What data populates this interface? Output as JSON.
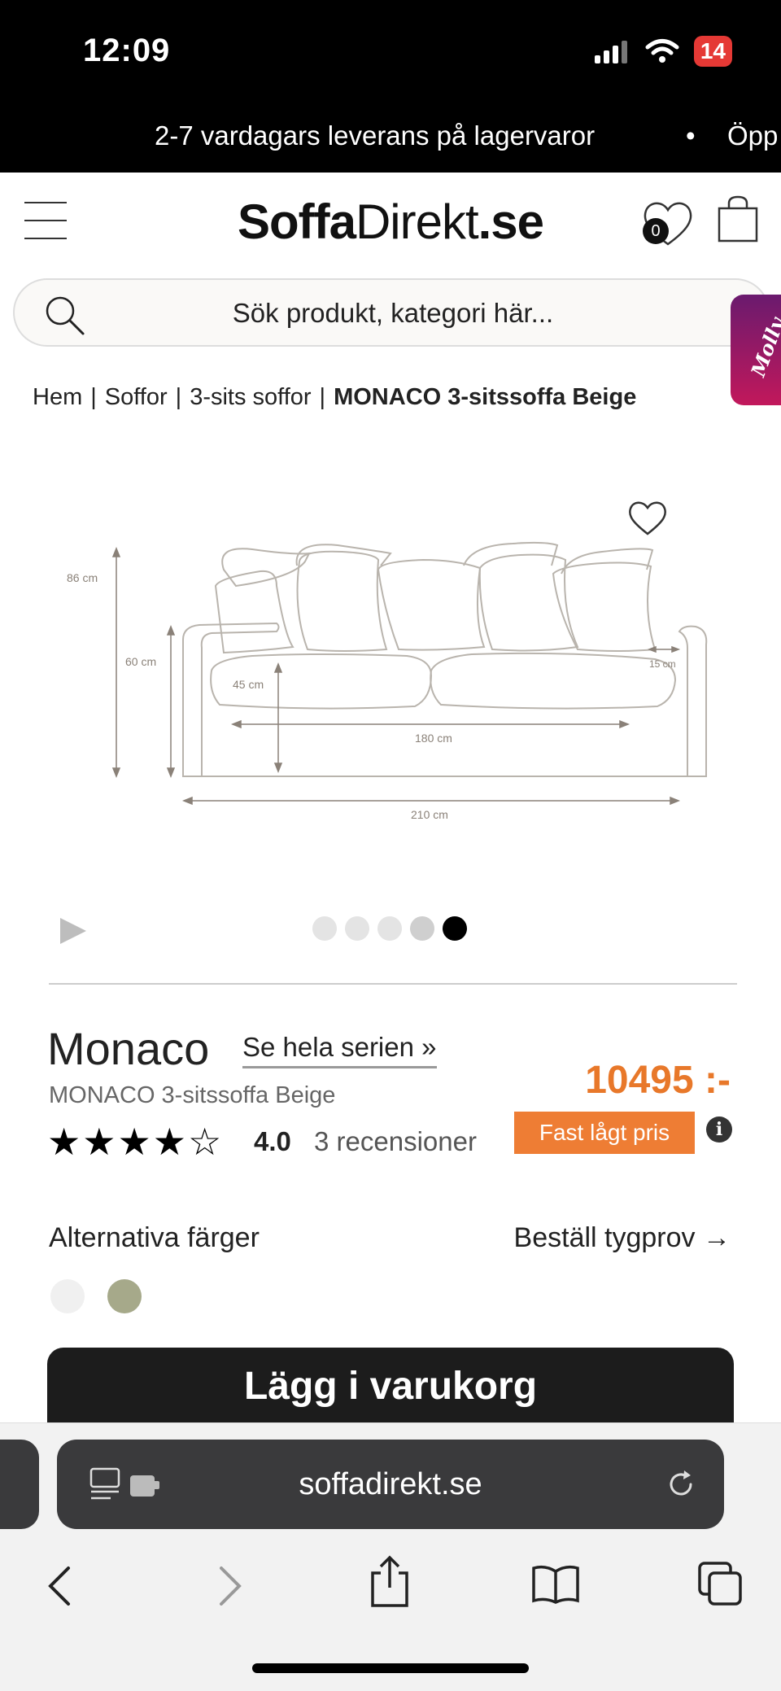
{
  "status_bar": {
    "time": "12:09",
    "battery": "14"
  },
  "announcement": {
    "text": "2-7 vardagars leverans på lagervaror",
    "separator": "•",
    "text_next": "Öpp"
  },
  "header": {
    "logo_bold": "Soffa",
    "logo_thin": "Direkt",
    "logo_suffix": ".se",
    "wishlist_count": "0"
  },
  "search": {
    "placeholder": "Sök produkt, kategori här..."
  },
  "chat_widget": {
    "label": "Molly"
  },
  "breadcrumb": {
    "items": [
      "Hem",
      "Soffor",
      "3-sits soffor"
    ],
    "current": "MONACO 3-sitssoffa Beige",
    "separator": "|"
  },
  "product_image": {
    "dimensions": {
      "height_total": "86 cm",
      "height_back": "60 cm",
      "seat_height": "45 cm",
      "seat_width": "180 cm",
      "total_width": "210 cm",
      "arm_width": "15 cm"
    },
    "carousel": {
      "slide_count": 5,
      "active_index": 4
    }
  },
  "product": {
    "title": "Monaco",
    "series_link": "Se hela serien »",
    "subtitle": "MONACO 3-sitssoffa Beige",
    "price": "10495 :-",
    "stars_display": "★★★★☆",
    "rating": "4.0",
    "reviews": "3 recensioner",
    "price_badge": "Fast lågt pris",
    "info_icon": "i"
  },
  "colors": {
    "label": "Alternativa färger",
    "order_sample": "Beställ tygprov →",
    "swatches": [
      "#f0f0f0",
      "#a6a98a"
    ]
  },
  "cta": {
    "add_to_cart": "Lägg i varukorg"
  },
  "browser": {
    "url": "soffadirekt.se"
  },
  "theme": {
    "accent_orange": "#ee7d34",
    "price_color": "#e8782a",
    "chat_gradient_start": "#6a1a6e",
    "chat_gradient_end": "#c2185b"
  }
}
